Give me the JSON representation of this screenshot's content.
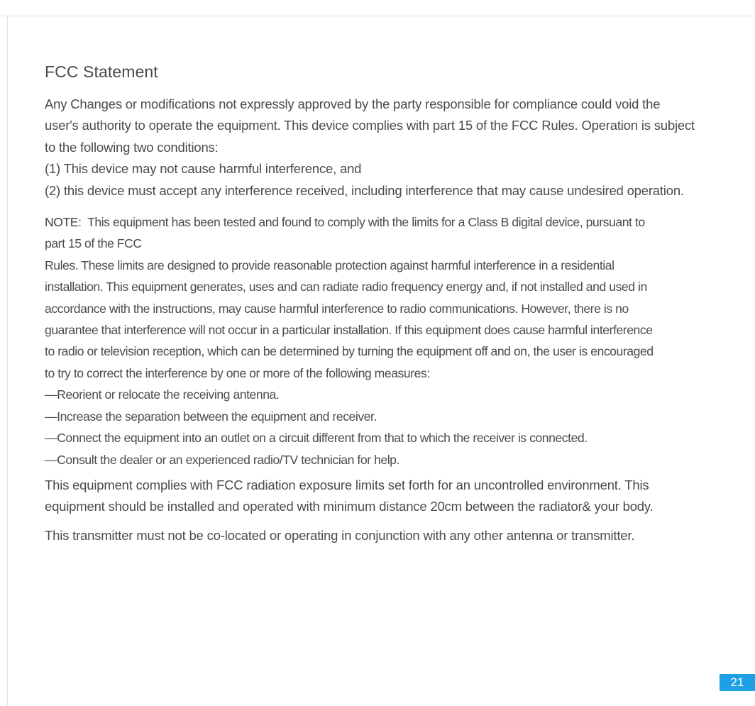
{
  "document": {
    "title": "FCC Statement",
    "intro_lines": [
      "Any Changes or modifications not expressly approved by the party responsible for compliance could void the",
      "user's authority to operate the equipment. This device complies with part 15 of the FCC Rules. Operation is subject",
      "to the following two conditions:",
      "(1) This device may not cause harmful interference, and",
      "(2) this device must accept any interference received, including interference that may cause undesired operation."
    ],
    "note": {
      "label": "NOTE:",
      "lines": [
        "This equipment has been tested and found to comply with the limits for a Class B digital device, pursuant to",
        "part 15 of the FCC",
        "Rules. These limits are designed to provide reasonable protection against harmful interference in a residential",
        "installation. This equipment generates, uses and can radiate radio frequency energy and, if not installed and used in",
        "accordance with the instructions, may cause harmful interference to radio communications. However, there is no",
        "guarantee that interference will not occur in a particular installation. If this equipment does cause harmful interference",
        "to radio or television reception, which can be determined by turning the equipment off and on, the user is encouraged",
        "to try to correct the interference by one or more of the following measures:"
      ],
      "measures": [
        "—Reorient or relocate the receiving antenna.",
        "—Increase the separation between the equipment and receiver.",
        "—Connect the equipment into an outlet on a circuit different from that to which the receiver is connected.",
        "—Consult the dealer or an experienced radio/TV technician for help."
      ]
    },
    "radiation_lines": [
      "This equipment complies with FCC radiation exposure limits set forth for an uncontrolled environment. This",
      "equipment should be installed and operated with minimum distance 20cm between the radiator& your body."
    ],
    "transmitter_line": "This transmitter must not be co-located or operating in conjunction with any other antenna or transmitter."
  },
  "page_number": "21",
  "colors": {
    "text": "#4b4b4b",
    "rule": "#e3e3e3",
    "badge": "#1ea0e5"
  }
}
